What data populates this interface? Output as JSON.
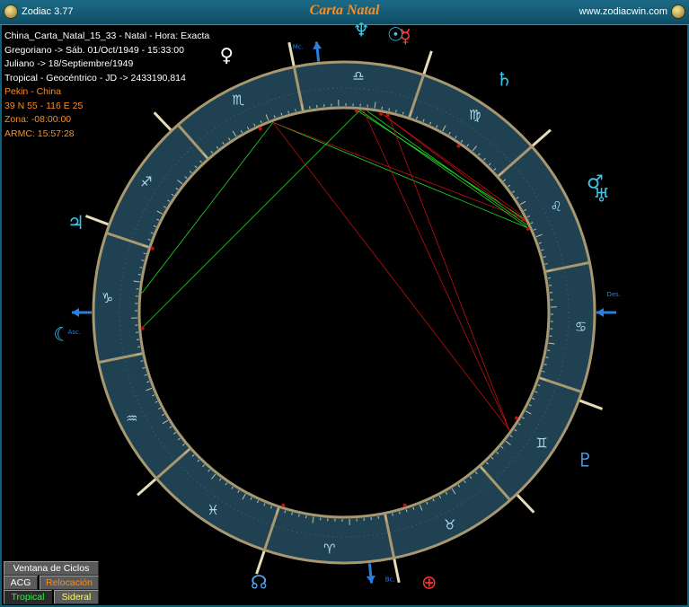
{
  "window": {
    "app_name": "Zodiac 3.77",
    "chart_title": "Carta Natal",
    "website": "www.zodiacwin.com"
  },
  "info": {
    "line1": "China_Carta_Natal_15_33 - Natal - Hora: Exacta",
    "line2": "Gregoriano -> Sáb. 01/Oct/1949 - 15:33:00",
    "line3": "Juliano -> 18/Septiembre/1949",
    "line4": "Tropical - Geocéntrico - JD -> 2433190,814",
    "line5": "Pekin - China",
    "line6": "39 N 55 - 116 E 25",
    "line7": "Zona: -08:00:00",
    "line8": "ARMC: 15:57:28"
  },
  "wheel": {
    "asc_degree": 288.5,
    "mc_degree": 204.3,
    "colors": {
      "ring": "#1f4152",
      "ring_border": "#a89870",
      "glyph": "#aadcf4",
      "cusp": "#e5dcb8",
      "axis": "#2a7fe0",
      "planet": "#3cc8ec",
      "planet_alt": "#4fa0f0",
      "aspect_hard": "#c01010",
      "aspect_soft": "#22dd22"
    },
    "signs": [
      "♈",
      "♉",
      "♊",
      "♋",
      "♌",
      "♍",
      "♎",
      "♏",
      "♐",
      "♑",
      "♒",
      "♓"
    ],
    "house_cusps": [
      288.5,
      330,
      0,
      30,
      62,
      88,
      108.5,
      150,
      180,
      210,
      242,
      268
    ],
    "axis_labels": {
      "asc": "Asc.",
      "mc": "Mc.",
      "des": "Des.",
      "ic": "Bc."
    },
    "planets": [
      {
        "name": "sun",
        "glyph": "☉",
        "lon": 188,
        "color": "#3cc8ec"
      },
      {
        "name": "moon",
        "glyph": "☾",
        "lon": 293,
        "color": "#3cc8ec"
      },
      {
        "name": "mercury",
        "glyph": "☿",
        "lon": 186,
        "color": "#ff4040"
      },
      {
        "name": "venus",
        "glyph": "♀",
        "lon": 223,
        "color": "#ffffff"
      },
      {
        "name": "mars",
        "glyph": "♂",
        "lon": 136,
        "color": "#3cc8ec"
      },
      {
        "name": "jupiter",
        "glyph": "♃",
        "lon": 270,
        "color": "#3cc8ec"
      },
      {
        "name": "saturn",
        "glyph": "♄",
        "lon": 164,
        "color": "#3cc8ec"
      },
      {
        "name": "uranus",
        "glyph": "♅",
        "lon": 133,
        "color": "#3cc8ec"
      },
      {
        "name": "neptune",
        "glyph": "♆",
        "lon": 195,
        "color": "#3cc8ec"
      },
      {
        "name": "pluto",
        "glyph": "♇",
        "lon": 77,
        "color": "#4fa0f0"
      },
      {
        "name": "node",
        "glyph": "☊",
        "lon": 1,
        "color": "#4fa0f0"
      },
      {
        "name": "fortune",
        "glyph": "⊕",
        "lon": 36,
        "color": "#ff3030"
      }
    ],
    "aspects": [
      {
        "a": 219,
        "b": 283,
        "type": "soft"
      },
      {
        "a": 219,
        "b": 133,
        "type": "soft"
      },
      {
        "a": 219,
        "b": 136,
        "type": "hard"
      },
      {
        "a": 219,
        "b": 73,
        "type": "hard"
      },
      {
        "a": 194,
        "b": 293,
        "type": "soft"
      },
      {
        "a": 194,
        "b": 133,
        "type": "soft"
      },
      {
        "a": 195,
        "b": 136,
        "type": "soft"
      },
      {
        "a": 192,
        "b": 134,
        "type": "soft"
      },
      {
        "a": 188,
        "b": 135,
        "type": "hard"
      },
      {
        "a": 186,
        "b": 73,
        "type": "hard"
      },
      {
        "a": 188,
        "b": 137,
        "type": "hard"
      },
      {
        "a": 193,
        "b": 73,
        "type": "hard"
      }
    ]
  },
  "buttons": {
    "cycles": "Ventana de Ciclos",
    "acg": "ACG",
    "relocation": "Relocación",
    "tropical": "Tropical",
    "sidereal": "Sideral"
  }
}
